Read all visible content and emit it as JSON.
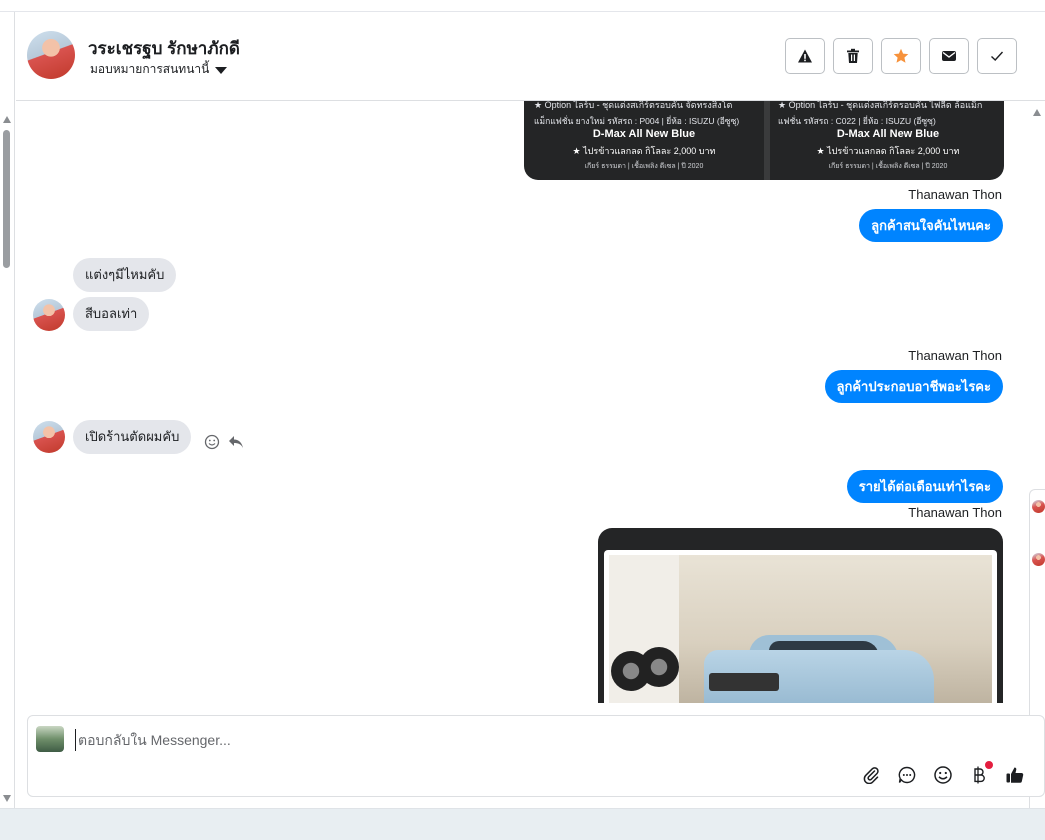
{
  "header": {
    "name": "วระเชรฐบ รักษาภักดี",
    "assign_label": "มอบหมายการสนทนานี้",
    "buttons": [
      {
        "icon": "warning-icon",
        "label": "Spam"
      },
      {
        "icon": "trash-icon",
        "label": "Delete"
      },
      {
        "icon": "star-icon",
        "label": "Star"
      },
      {
        "icon": "envelope-icon",
        "label": "Mark unread"
      },
      {
        "icon": "check-icon",
        "label": "Done"
      }
    ]
  },
  "product_cards": [
    {
      "line1": "★ Option ไลร์บ - ชุดแต่งสเกิร์ตรอบคัน จัดทรงสิงโต",
      "line2": "แม็กแฟชั่น ยางใหม่ รหัสรถ : P004 | ยี่ห้อ : ISUZU (อีซูซุ)",
      "title": "D-Max All New Blue",
      "offer": "★ ไปรข้าวแลกลด กิโลละ 2,000 บาท",
      "meta": "เกียร์ ธรรมดา | เชื้อเพลิง ดีเซล | ปี 2020"
    },
    {
      "line1": "★ Option ไลร์บ - ชุดแต่งสเกิร์ตรอบคัน ไฟลีด ล้อแม็ก",
      "line2": "แฟชั่น รหัสรถ : C022 | ยี่ห้อ : ISUZU (อีซูซุ)",
      "title": "D-Max All New Blue",
      "offer": "★ ไปรข้าวแลกลด กิโลละ 2,000 บาท",
      "meta": "เกียร์ ธรรมดา | เชื้อเพลิง ดีเซล | ปี 2020"
    }
  ],
  "messages": {
    "sender_1": "Thanawan Thon",
    "out_1": "ลูกค้าสนใจคันไหนคะ",
    "in_1": "แต่งๆมีไหมคับ",
    "in_2": "สีบอลเท่า",
    "sender_2": "Thanawan Thon",
    "out_2": "ลูกค้าประกอบอาชีพอะไรคะ",
    "in_3": "เปิดร้านตัดผมคับ",
    "out_3": "รายได้ต่อเดือนเท่าไรคะ",
    "sender_3": "Thanawan Thon"
  },
  "composer": {
    "placeholder": "ตอบกลับใน Messenger...",
    "tools": [
      "paperclip-icon",
      "chat-bubble-icon",
      "smiley-icon",
      "baht-icon",
      "thumbs-up-icon"
    ]
  },
  "colors": {
    "outgoing_bubble": "#0084ff",
    "incoming_bubble": "#e4e6eb",
    "star_accent": "#f7923b",
    "notification_dot": "#e41e3f"
  }
}
